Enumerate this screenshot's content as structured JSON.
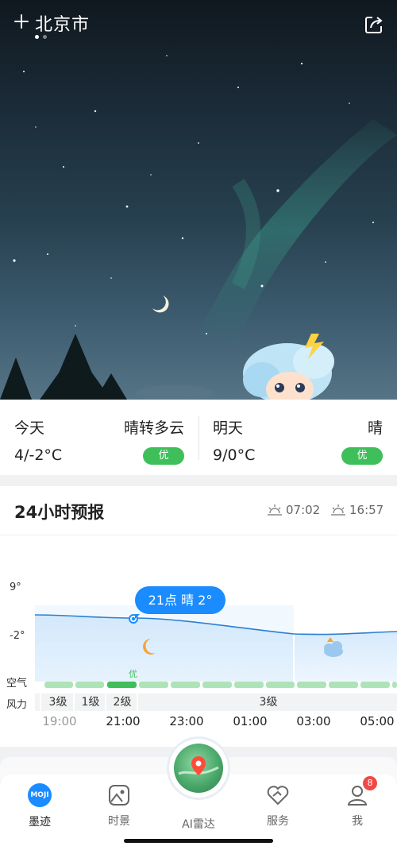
{
  "header": {
    "city": "北京市",
    "page_count": 2,
    "active_page": 0
  },
  "today": {
    "label": "今天",
    "condition": "晴转多云",
    "temp": "4/-2°C",
    "aqi": "优"
  },
  "tomorrow": {
    "label": "明天",
    "condition": "晴",
    "temp": "9/0°C",
    "aqi": "优"
  },
  "forecast": {
    "title": "24小时预报",
    "sunrise": "07:02",
    "sunset": "16:57",
    "y_high": "9°",
    "y_low": "-2°",
    "tooltip": "21点 晴 2°",
    "air_label": "空气",
    "air_best_label": "优",
    "wind_label": "风力",
    "wind_cells": [
      "3级",
      "1级",
      "2级",
      "3级"
    ],
    "times": [
      "19:00",
      "21:00",
      "23:00",
      "01:00",
      "03:00",
      "05:00"
    ]
  },
  "nav": {
    "items": [
      {
        "label": "墨迹",
        "logo_text": "MOJI"
      },
      {
        "label": "时景"
      },
      {
        "label": "AI雷达"
      },
      {
        "label": "服务"
      },
      {
        "label": "我",
        "badge": "8"
      }
    ]
  },
  "colors": {
    "accent": "#1a8cff",
    "good_aqi": "#3fbf5a",
    "badge": "#f04848"
  }
}
